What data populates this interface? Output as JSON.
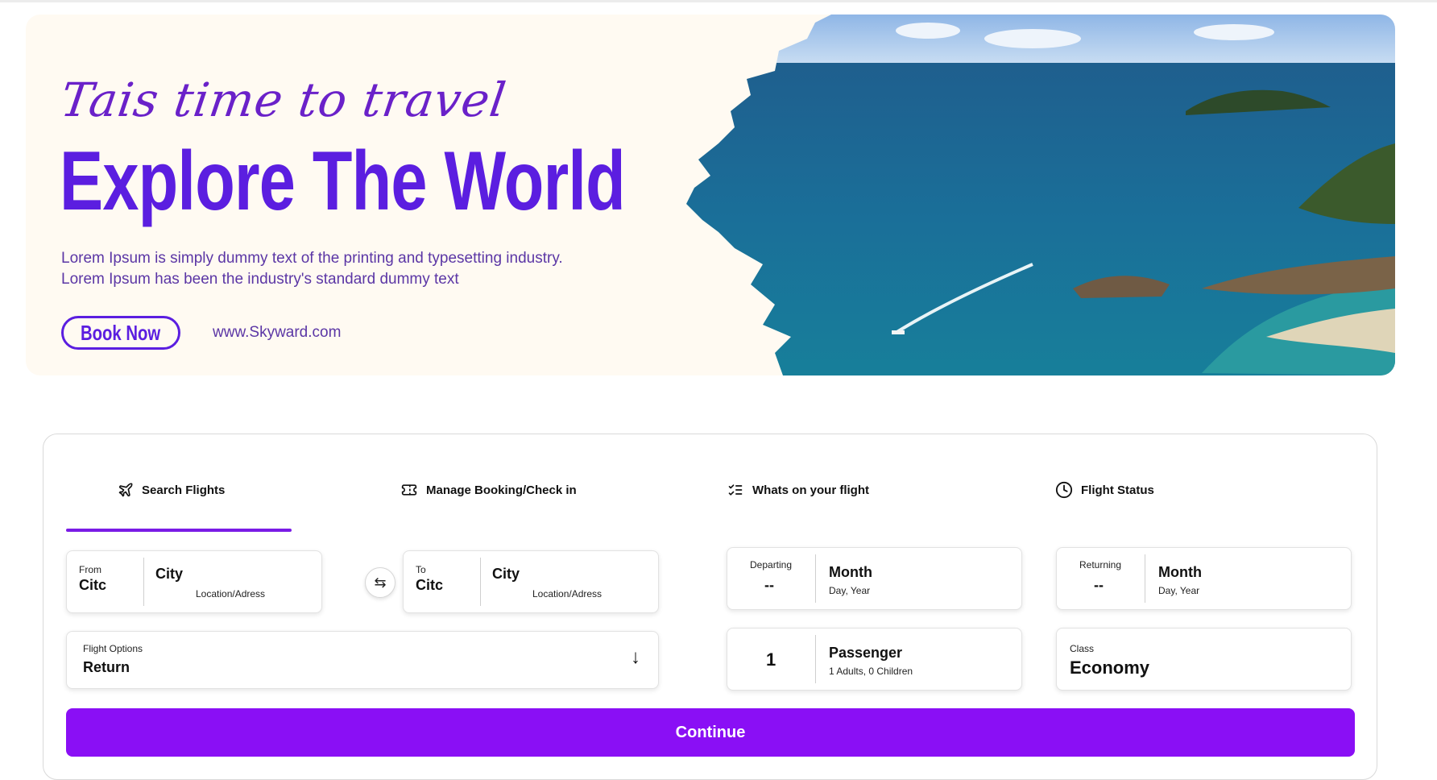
{
  "banner": {
    "tagline": "Tais time to travel",
    "headline": "Explore The World",
    "description_line1": "Lorem Ipsum is simply dummy text of the printing and typesetting industry.",
    "description_line2": "Lorem Ipsum has been the industry's standard dummy text",
    "book_button": "Book Now",
    "website": "www.Skyward.com",
    "accent_color": "#5b1ee0"
  },
  "tabs": [
    {
      "label": "Search Flights",
      "icon": "airplane-icon",
      "active": true
    },
    {
      "label": "Manage Booking/Check in",
      "icon": "ticket-icon",
      "active": false
    },
    {
      "label": "Whats on your flight",
      "icon": "checklist-icon",
      "active": false
    },
    {
      "label": "Flight Status",
      "icon": "clock-icon",
      "active": false
    }
  ],
  "from": {
    "label": "From",
    "code": "Citc",
    "city": "City",
    "location": "Location/Adress"
  },
  "to": {
    "label": "To",
    "code": "Citc",
    "city": "City",
    "location": "Location/Adress"
  },
  "departing": {
    "label": "Departing",
    "value": "--",
    "month": "Month",
    "sub": "Day, Year"
  },
  "returning": {
    "label": "Returning",
    "value": "--",
    "month": "Month",
    "sub": "Day, Year"
  },
  "flight_options": {
    "label": "Flight Options",
    "value": "Return"
  },
  "passengers": {
    "count": "1",
    "label": "Passenger",
    "sub": "1 Adults, 0 Children"
  },
  "class": {
    "label": "Class",
    "value": "Economy"
  },
  "continue_button": "Continue",
  "button_color": "#8a0ff5"
}
